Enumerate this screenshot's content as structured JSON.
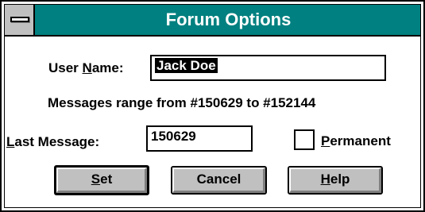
{
  "window": {
    "title": "Forum Options"
  },
  "user_name": {
    "label_prefix": "User ",
    "label_accel": "N",
    "label_suffix": "ame:",
    "value": "Jack Doe"
  },
  "range_text": "Messages range from #150629 to #152144",
  "last_message": {
    "label_accel": "L",
    "label_suffix": "ast Message:",
    "value": "150629"
  },
  "permanent": {
    "label_accel": "P",
    "label_suffix": "ermanent",
    "checked": false
  },
  "buttons": {
    "set": {
      "accel": "S",
      "rest": "et"
    },
    "cancel": {
      "label": "Cancel"
    },
    "help": {
      "accel": "H",
      "rest": "elp"
    }
  },
  "colors": {
    "titlebar": "#008080",
    "button_face": "#c0c0c0"
  }
}
